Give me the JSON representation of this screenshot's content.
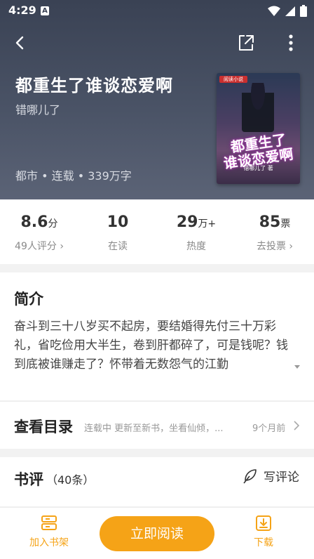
{
  "status_bar": {
    "time": "4:29",
    "notification_icon": "A"
  },
  "header": {
    "back_icon": "chevron-left-icon",
    "share_icon": "share-icon",
    "more_icon": "more-vertical-icon",
    "book_title": "都重生了谁谈恋爱啊",
    "author": "错哪儿了",
    "meta": "都市 • 连载 • 339万字",
    "cover": {
      "publisher_badge": "阅读小说",
      "title_line1": "都重生了",
      "title_line2": "谁谈恋爱啊",
      "author_line": "错哪儿了 著"
    }
  },
  "stats": [
    {
      "value": "8.6",
      "unit": "分",
      "sub": "49人评分",
      "has_arrow": true
    },
    {
      "value": "10",
      "unit": "",
      "sub": "在读",
      "has_arrow": false
    },
    {
      "value": "29",
      "unit": "万+",
      "sub": "热度",
      "has_arrow": false
    },
    {
      "value": "85",
      "unit": "票",
      "sub": "去投票",
      "has_arrow": true
    }
  ],
  "intro": {
    "heading": "简介",
    "text": "奋斗到三十八岁买不起房，要结婚得先付三十万彩礼，省吃俭用大半生，卷到肝都碎了，可是钱呢？钱到底被谁赚走了？怀带着无数怨气的江勤"
  },
  "catalog": {
    "heading": "查看目录",
    "info": "连载中 更新至新书，坐看仙倾，...",
    "time": "9个月前"
  },
  "reviews": {
    "heading": "书评",
    "count": "（40条）",
    "write_label": "写评论"
  },
  "bottom_bar": {
    "shelf_label": "加入书架",
    "read_label": "立即阅读",
    "download_label": "下载"
  },
  "colors": {
    "accent": "#f5a317",
    "header_bg": "#3a4254"
  }
}
